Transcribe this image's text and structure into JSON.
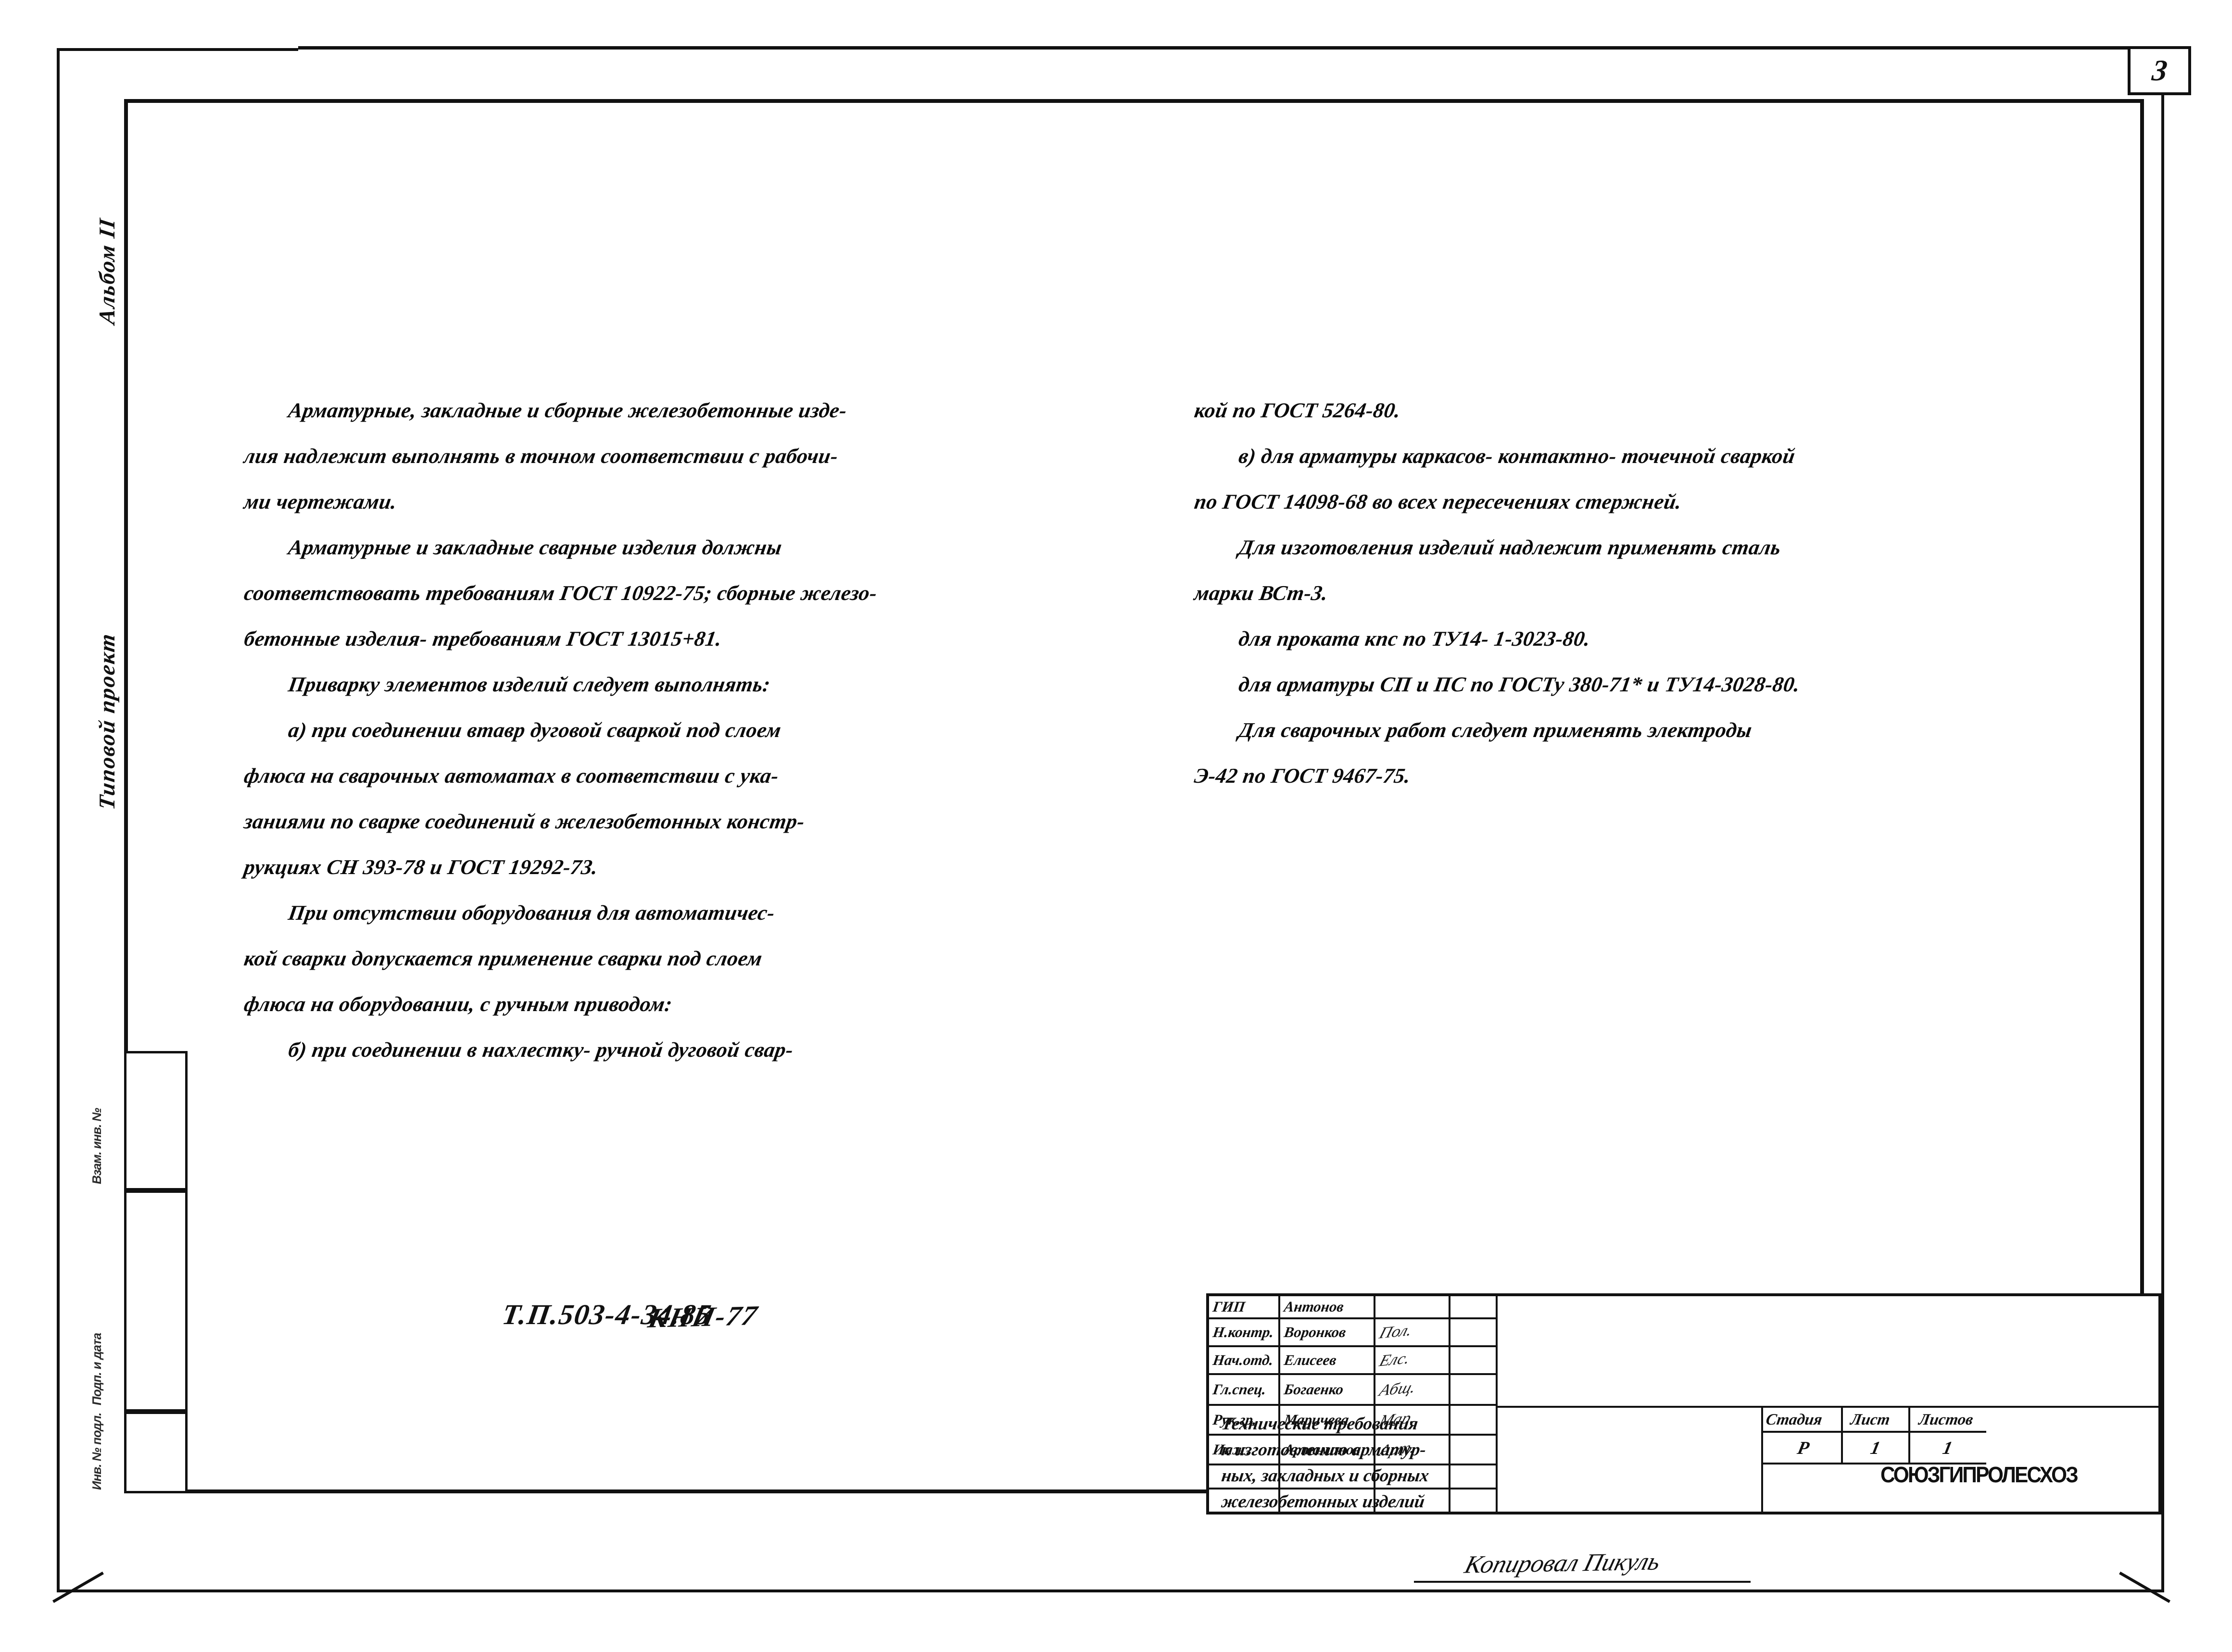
{
  "page": {
    "number": "3"
  },
  "margin": {
    "album_label": "Альбом II",
    "project_label": "Типовой проект",
    "gost_boxes": [
      {
        "label": "Взам. инв. №"
      },
      {
        "label": "Подп. и дата"
      },
      {
        "label": "Инв. № подл."
      }
    ]
  },
  "columns": {
    "left": [
      {
        "text": "Арматурные, закладные и сборные железобетонные изде-",
        "indent": true
      },
      {
        "text": "лия надлежит выполнять в точном соответствии с рабочи-",
        "indent": false
      },
      {
        "text": "ми чертежами.",
        "indent": false
      },
      {
        "text": "Арматурные и закладные сварные изделия должны",
        "indent": true
      },
      {
        "text": "соответствовать требованиям ГОСТ 10922-75; сборные железо-",
        "indent": false
      },
      {
        "text": "бетонные изделия- требованиям  ГОСТ 13015+81.",
        "indent": false
      },
      {
        "text": "Приварку элементов изделий следует выполнять:",
        "indent": true
      },
      {
        "text": "а) при соединении втавр дуговой сваркой под слоем",
        "indent": true
      },
      {
        "text": "флюса на сварочных автоматах в соответствии с ука-",
        "indent": false
      },
      {
        "text": "заниями по сварке соединений в железобетонных констр-",
        "indent": false
      },
      {
        "text": "рукциях СН 393-78 и ГОСТ 19292-73.",
        "indent": false
      },
      {
        "text": "При отсутствии оборудования для автоматичес-",
        "indent": true
      },
      {
        "text": "кой сварки допускается  применение сварки под слоем",
        "indent": false
      },
      {
        "text": "флюса на оборудовании, с ручным приводом:",
        "indent": false
      },
      {
        "text": "б) при соединении  в нахлестку- ручной дуговой свар-",
        "indent": true
      }
    ],
    "right": [
      {
        "text": "кой по ГОСТ 5264-80.",
        "indent": false
      },
      {
        "text": "в) для арматуры каркасов- контактно- точечной сваркой",
        "indent": true
      },
      {
        "text": "по ГОСТ 14098-68 во всех пересечениях стержней.",
        "indent": false
      },
      {
        "text": "Для изготовления изделий надлежит применять сталь",
        "indent": true
      },
      {
        "text": "марки ВСт-3.",
        "indent": false
      },
      {
        "text": "для проката кпс по ТУ14- 1-3023-80.",
        "indent": true
      },
      {
        "text": "для арматуры СП и ПС по ГОСТу 380-71* и ТУ14-3028-80.",
        "indent": true
      },
      {
        "text": "Для сварочных работ следует применять электроды",
        "indent": true
      },
      {
        "text": "Э-42  по ГОСТ 9467-75.",
        "indent": false
      }
    ]
  },
  "stamp": {
    "roles": [
      {
        "role": "ГИП",
        "name": "Антонов",
        "signature": ""
      },
      {
        "role": "Н.контр.",
        "name": "Воронков",
        "signature": "Пол."
      },
      {
        "role": "Нач.отд.",
        "name": "Елисеев",
        "signature": "Елс."
      },
      {
        "role": "Гл.спец.",
        "name": "Богаенко",
        "signature": "Абщ."
      },
      {
        "role": "Рук.гр.",
        "name": "Маричева",
        "signature": "Мар."
      },
      {
        "role": "Инж.",
        "name": "Артамонов",
        "signature": "Арт."
      }
    ],
    "project_code": "Т.П.503-4-34.85",
    "sheet_code": "КНИ-77",
    "title_lines": [
      "Технические требования",
      "к изготовлению арматур-",
      "ных, закладных и сборных",
      "железобетонных изделий"
    ],
    "stage_headers": [
      "Стадия",
      "Лист",
      "Листов"
    ],
    "stage_values": [
      "Р",
      "1",
      "1"
    ],
    "organization": "СОЮЗГИПРОЛЕСХОЗ"
  },
  "footer": {
    "copier_note": "Копировал Пикуль"
  },
  "colors": {
    "ink": "#0a0a0a",
    "paper": "#ffffff"
  }
}
